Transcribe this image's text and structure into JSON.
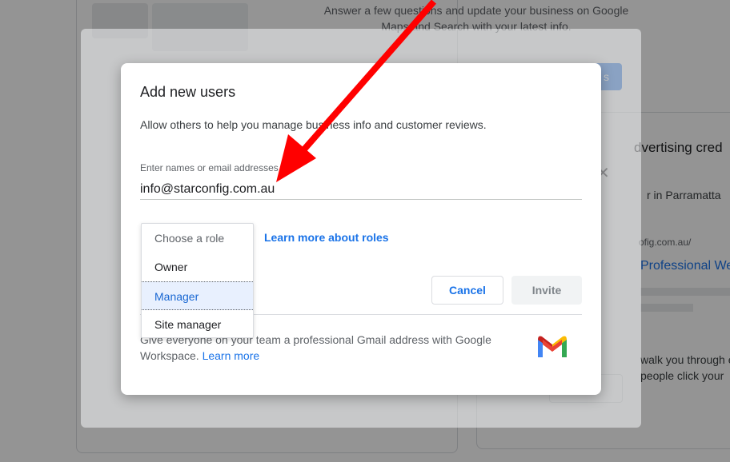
{
  "background": {
    "intro_text_line1": "Answer a few questions and update your business on Google",
    "intro_text_line2": "Maps and Search with your latest info.",
    "blue_button_label": "s",
    "right_panel_title": "dvertising cred",
    "right_panel_line1": "r in Parramatta",
    "right_panel_url": "ofig.com.au/",
    "right_panel_link": "Professional We",
    "right_panel_line3": "walk you through e",
    "right_panel_line4": "people click your"
  },
  "dialog": {
    "title": "Add new users",
    "description": "Allow others to help you manage business info and customer reviews.",
    "email_field_label": "Enter names or email addresses",
    "email_value": "info@starconfig.com.au",
    "learn_roles_link": "Learn more about roles",
    "cancel_label": "Cancel",
    "invite_label": "Invite",
    "promo_text": "Give everyone on your team a professional Gmail address with Google Workspace.",
    "promo_link": "Learn more"
  },
  "role_dropdown": {
    "placeholder": "Choose a role",
    "options": [
      "Owner",
      "Manager",
      "Site manager"
    ],
    "highlighted": "Manager"
  },
  "colors": {
    "accent": "#1a73e8",
    "annotation_arrow": "#ff0000",
    "highlight_bg": "#e8f0fe"
  },
  "icons": {
    "close": "close-icon",
    "gmail": "gmail-logo-icon"
  }
}
